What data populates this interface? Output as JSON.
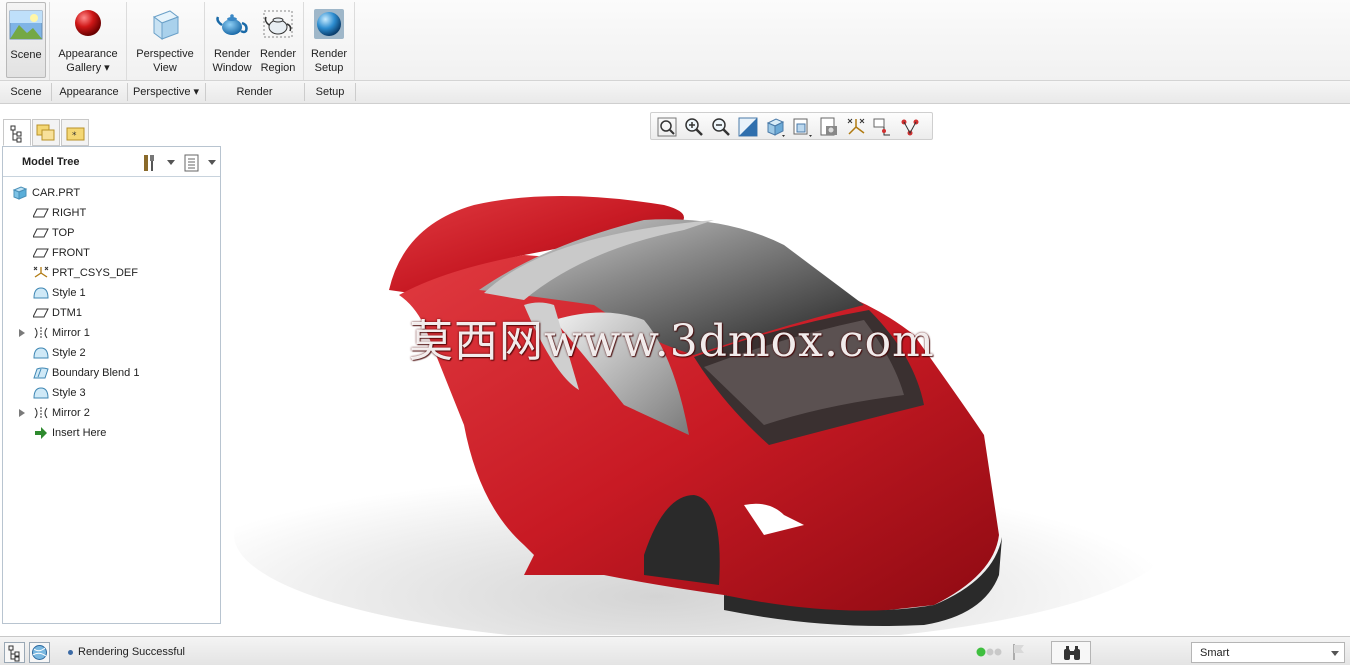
{
  "ribbon": {
    "buttons": [
      {
        "label1": "Scene",
        "label2": ""
      },
      {
        "label1": "Appearance",
        "label2": "Gallery ▾"
      },
      {
        "label1": "Perspective",
        "label2": "View"
      },
      {
        "label1": "Render",
        "label2": "Window"
      },
      {
        "label1": "Render",
        "label2": "Region"
      },
      {
        "label1": "Render",
        "label2": "Setup"
      }
    ],
    "groups": [
      "Scene",
      "Appearance",
      "Perspective ▾",
      "Render",
      "Setup"
    ]
  },
  "model_tree": {
    "title": "Model Tree",
    "items": [
      {
        "label": "CAR.PRT",
        "icon": "part-icon"
      },
      {
        "label": "RIGHT",
        "icon": "datum-plane-icon"
      },
      {
        "label": "TOP",
        "icon": "datum-plane-icon"
      },
      {
        "label": "FRONT",
        "icon": "datum-plane-icon"
      },
      {
        "label": "PRT_CSYS_DEF",
        "icon": "csys-icon"
      },
      {
        "label": "Style 1",
        "icon": "style-icon"
      },
      {
        "label": "DTM1",
        "icon": "datum-plane-icon"
      },
      {
        "label": "Mirror 1",
        "icon": "mirror-icon",
        "expandable": true
      },
      {
        "label": "Style 2",
        "icon": "style-icon"
      },
      {
        "label": "Boundary Blend 1",
        "icon": "boundary-blend-icon"
      },
      {
        "label": "Style 3",
        "icon": "style-icon"
      },
      {
        "label": "Mirror 2",
        "icon": "mirror-icon",
        "expandable": true
      },
      {
        "label": "Insert Here",
        "icon": "insert-arrow-icon"
      }
    ]
  },
  "viewport": {
    "watermark": "莫西网www.3dmox.com",
    "toolbar": [
      "refit-icon",
      "zoom-in-icon",
      "zoom-out-icon",
      "repaint-icon",
      "display-style-icon",
      "saved-views-icon",
      "view-manager-icon",
      "datum-display-icon",
      "spin-center-icon",
      "annotation-icon"
    ]
  },
  "status": {
    "message": "Rendering Successful",
    "filter": "Smart"
  },
  "colors": {
    "car_body": "#d0202a",
    "glass": "#2a2a2a",
    "panel_border": "#b8c4d0"
  }
}
